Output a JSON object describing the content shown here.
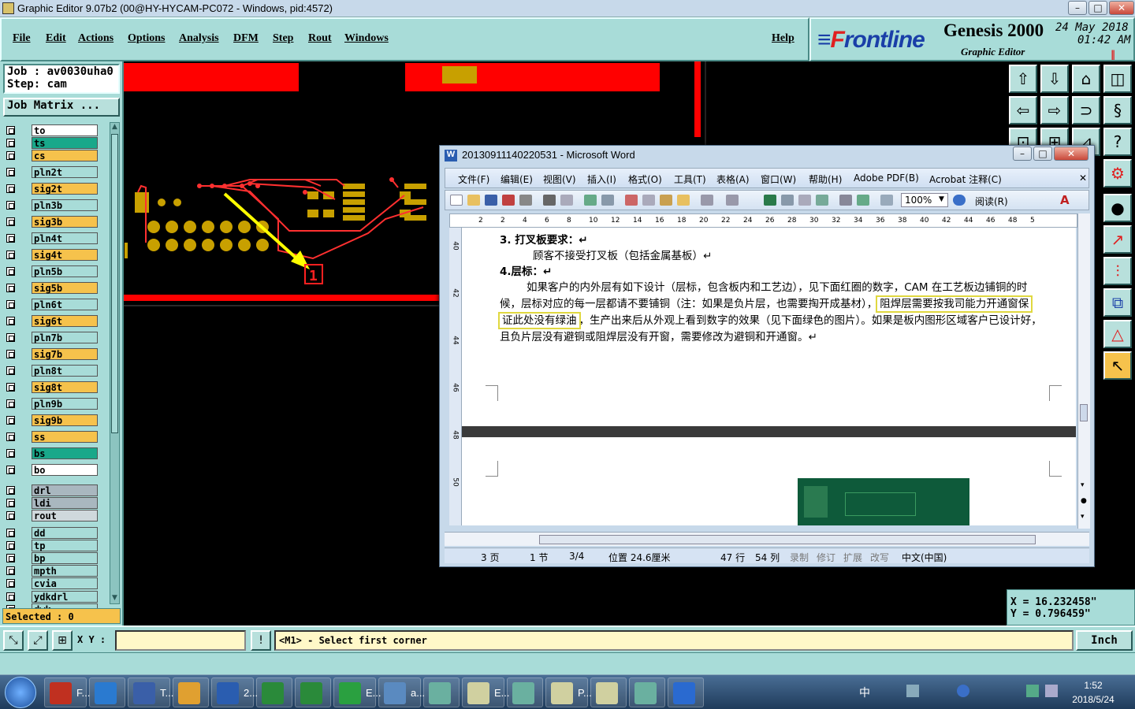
{
  "window": {
    "title": "Graphic Editor 9.07b2 (00@HY-HYCAM-PC072 - Windows, pid:4572)"
  },
  "menu": [
    {
      "label": "File"
    },
    {
      "label": "Edit"
    },
    {
      "label": "Actions"
    },
    {
      "label": "Options"
    },
    {
      "label": "Analysis"
    },
    {
      "label": "DFM"
    },
    {
      "label": "Step"
    },
    {
      "label": "Rout"
    },
    {
      "label": "Windows"
    },
    {
      "label": "Help"
    }
  ],
  "brand": {
    "logo_a": "F",
    "logo_b": "rontline",
    "product": "Genesis 2000",
    "module": "Graphic Editor",
    "date": "24 May 2018",
    "time": "01:42 AM"
  },
  "job": {
    "job_line": "Job : av0030uha0",
    "step_line": "Step: cam",
    "matrix_button": "Job Matrix ..."
  },
  "layers": [
    {
      "name": "to",
      "color": "#ffffff"
    },
    {
      "name": "ts",
      "color": "#19a88a"
    },
    {
      "name": "cs",
      "color": "#f6c24c"
    },
    {
      "name": "pln2t",
      "color": "#a8dcd8"
    },
    {
      "name": "sig2t",
      "color": "#f6c24c"
    },
    {
      "name": "pln3b",
      "color": "#a8dcd8"
    },
    {
      "name": "sig3b",
      "color": "#f6c24c"
    },
    {
      "name": "pln4t",
      "color": "#a8dcd8"
    },
    {
      "name": "sig4t",
      "color": "#f6c24c"
    },
    {
      "name": "pln5b",
      "color": "#a8dcd8"
    },
    {
      "name": "sig5b",
      "color": "#f6c24c"
    },
    {
      "name": "pln6t",
      "color": "#a8dcd8"
    },
    {
      "name": "sig6t",
      "color": "#f6c24c"
    },
    {
      "name": "pln7b",
      "color": "#a8dcd8"
    },
    {
      "name": "sig7b",
      "color": "#f6c24c"
    },
    {
      "name": "pln8t",
      "color": "#a8dcd8"
    },
    {
      "name": "sig8t",
      "color": "#f6c24c"
    },
    {
      "name": "pln9b",
      "color": "#a8dcd8"
    },
    {
      "name": "sig9b",
      "color": "#f6c24c"
    },
    {
      "name": "ss",
      "color": "#f6c24c"
    },
    {
      "name": "bs",
      "color": "#19a88a"
    },
    {
      "name": "bo",
      "color": "#ffffff"
    },
    {
      "name": "drl",
      "color": "#a9b7bf"
    },
    {
      "name": "ldi",
      "color": "#a9b7bf"
    },
    {
      "name": "rout",
      "color": "#cfd8dc"
    },
    {
      "name": "dd",
      "color": "#a8dcd8"
    },
    {
      "name": "tp",
      "color": "#a8dcd8"
    },
    {
      "name": "bp",
      "color": "#a8dcd8"
    },
    {
      "name": "mpth",
      "color": "#a8dcd8"
    },
    {
      "name": "cvia",
      "color": "#a8dcd8"
    },
    {
      "name": "ydkdrl",
      "color": "#a8dcd8"
    },
    {
      "name": "dwk",
      "color": "#a8dcd8"
    }
  ],
  "selected": "Selected : 0",
  "coords": {
    "x": "X  = 16.232458\"",
    "y": "Y  = 0.796459\""
  },
  "cmd": {
    "xy_label": "X Y :",
    "prompt": "<M1> - Select first corner",
    "units": "Inch"
  },
  "canvas": {
    "marker": "1"
  },
  "word": {
    "title": "20130911140220531 - Microsoft Word",
    "menu": [
      "文件(F)",
      "编辑(E)",
      "视图(V)",
      "插入(I)",
      "格式(O)",
      "工具(T)",
      "表格(A)",
      "窗口(W)",
      "帮助(H)",
      "Adobe PDF(B)",
      "Acrobat 注释(C)"
    ],
    "zoom": "100%",
    "read_btn": "阅读(R)",
    "ruler": [
      "2",
      "2",
      "4",
      "6",
      "8",
      "10",
      "12",
      "14",
      "16",
      "18",
      "20",
      "22",
      "24",
      "26",
      "28",
      "30",
      "32",
      "34",
      "36",
      "38",
      "40",
      "42",
      "44",
      "46",
      "48",
      "5"
    ],
    "vruler": [
      "40",
      "42",
      "44",
      "46",
      "48",
      "50"
    ],
    "doc": {
      "h3": "3.  打叉板要求：↵",
      "p3": "顾客不接受打叉板（包括金属基板）↵",
      "h4": "4.层标：↵",
      "l1": "如果客户的内外层有如下设计（层标，包含板内和工艺边），见下面红圈的数字，CAM 在工艺板边铺铜的时",
      "l2a": "候，层标对应的每一层都请不要铺铜（注：如果是负片层，也需要掏开成基材），",
      "l2b": "阻焊层需要按我司能力开通窗保",
      "l3a": "证此处没有绿油",
      "l3b": "，生产出来后从外观上看到数字的效果（见下面绿色的图片）。如果是板内图形区域客户已设计好，",
      "l4": "且负片层没有避铜或阻焊层没有开窗，需要修改为避铜和开通窗。↵"
    },
    "status": {
      "page": "3 页",
      "section": "1 节",
      "pages": "3/4",
      "pos": "位置 24.6厘米",
      "line": "47 行",
      "col": "54 列",
      "rec": "录制",
      "rev": "修订",
      "ext": "扩展",
      "ovr": "改写",
      "lang": "中文(中国)"
    }
  },
  "taskbar": {
    "items": [
      {
        "label": "F..."
      },
      {
        "label": ""
      },
      {
        "label": "T..."
      },
      {
        "label": ""
      },
      {
        "label": "2..."
      },
      {
        "label": ""
      },
      {
        "label": ""
      },
      {
        "label": "E..."
      },
      {
        "label": "a..."
      },
      {
        "label": ""
      },
      {
        "label": "E..."
      },
      {
        "label": ""
      },
      {
        "label": "P..."
      },
      {
        "label": ""
      },
      {
        "label": ""
      },
      {
        "label": ""
      }
    ],
    "ime": "中",
    "clock_time": "1:52",
    "clock_date": "2018/5/24"
  }
}
